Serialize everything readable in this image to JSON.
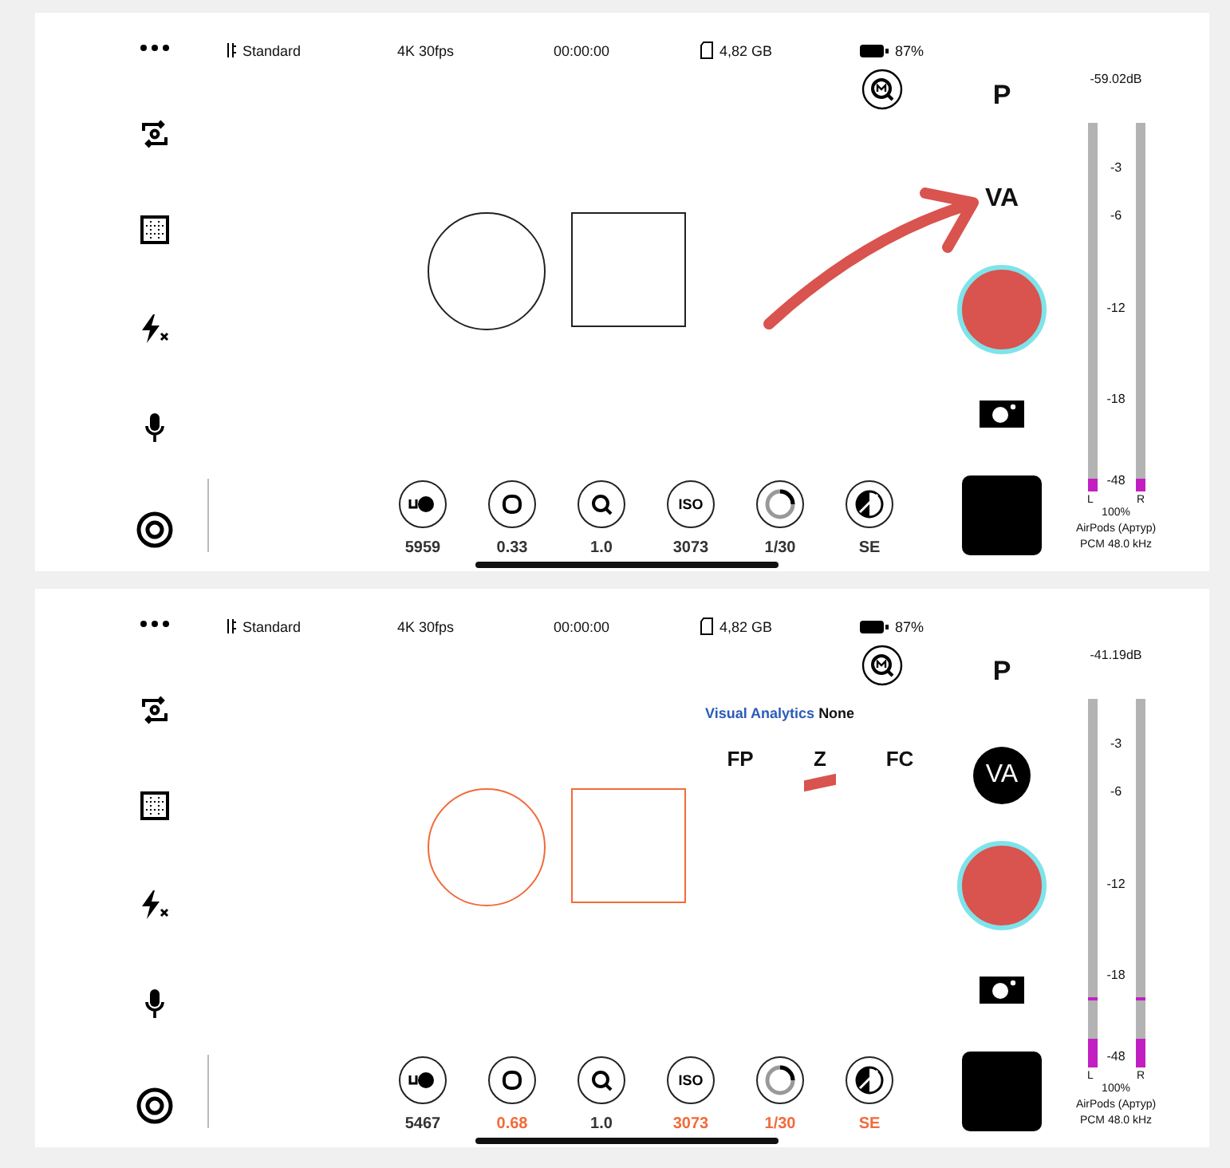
{
  "panels": [
    {
      "status_bar": {
        "stabilization": "Standard",
        "format": "4K 30fps",
        "timecode": "00:00:00",
        "storage": "4,82 GB",
        "battery": "87%"
      },
      "arrow_annotation": true,
      "framing_active": false,
      "controls": [
        {
          "kind": "white-balance",
          "value": "5959",
          "active": false
        },
        {
          "kind": "aperture",
          "value": "0.33",
          "active": false
        },
        {
          "kind": "zoom",
          "value": "1.0",
          "active": false
        },
        {
          "kind": "iso",
          "icon_text": "ISO",
          "value": "3073",
          "active": false
        },
        {
          "kind": "shutter",
          "value": "1/30",
          "active": false
        },
        {
          "kind": "exposure",
          "value": "SE",
          "active": false
        }
      ],
      "mode": "P",
      "va": {
        "label": "VA",
        "selected": false
      },
      "audio": {
        "reading": "-59.02dB",
        "scale": [
          "-3",
          "-6",
          "-12",
          "-18",
          "-48"
        ],
        "channels": [
          {
            "label": "L",
            "level": 0.035
          },
          {
            "label": "R",
            "level": 0.035
          }
        ],
        "gain": "100%",
        "device": "AirPods (Артур)",
        "format": "PCM 48.0 kHz"
      }
    },
    {
      "status_bar": {
        "stabilization": "Standard",
        "format": "4K 30fps",
        "timecode": "00:00:00",
        "storage": "4,82 GB",
        "battery": "87%"
      },
      "framing_active": true,
      "visual_analytics": {
        "label": "Visual Analytics",
        "value": "None",
        "modes": [
          {
            "label": "FP",
            "selected": false
          },
          {
            "label": "Z",
            "selected": true
          },
          {
            "label": "FC",
            "selected": false
          }
        ]
      },
      "controls": [
        {
          "kind": "white-balance",
          "value": "5467",
          "active": false
        },
        {
          "kind": "aperture",
          "value": "0.68",
          "active": true
        },
        {
          "kind": "zoom",
          "value": "1.0",
          "active": false
        },
        {
          "kind": "iso",
          "icon_text": "ISO",
          "value": "3073",
          "active": true
        },
        {
          "kind": "shutter",
          "value": "1/30",
          "active": true
        },
        {
          "kind": "exposure",
          "value": "SE",
          "active": true
        }
      ],
      "mode": "P",
      "va": {
        "label": "VA",
        "selected": true
      },
      "audio": {
        "reading": "-41.19dB",
        "scale": [
          "-3",
          "-6",
          "-12",
          "-18",
          "-48"
        ],
        "channels": [
          {
            "label": "L",
            "level": 0.08,
            "peak": {
              "level": 0.18
            }
          },
          {
            "label": "R",
            "level": 0.08,
            "peak": {
              "level": 0.18
            }
          }
        ],
        "gain": "100%",
        "device": "AirPods (Артур)",
        "format": "PCM 48.0 kHz"
      }
    }
  ]
}
